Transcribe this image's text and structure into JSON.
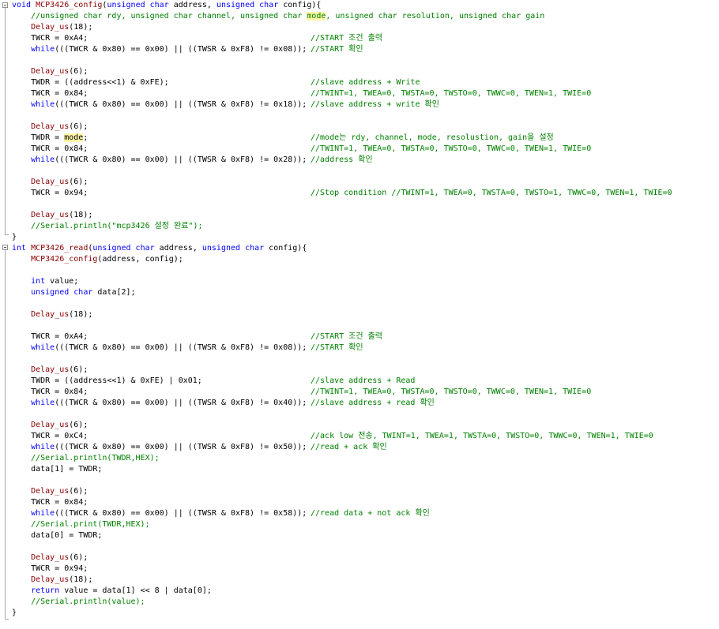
{
  "editor": {
    "lines": [
      {
        "segments": [
          {
            "t": "void",
            "c": "kw"
          },
          {
            "t": " "
          },
          {
            "t": "MCP3426_config",
            "c": "fn"
          },
          {
            "t": "("
          },
          {
            "t": "unsigned char",
            "c": "kw"
          },
          {
            "t": " address, "
          },
          {
            "t": "unsigned char",
            "c": "kw"
          },
          {
            "t": " config){"
          }
        ]
      },
      {
        "segments": [
          {
            "t": "    //unsigned char rdy, unsigned char channel, unsigned char ",
            "c": "green"
          },
          {
            "t": "mode",
            "c": "green hl"
          },
          {
            "t": ", unsigned char resolution, unsigned char gain",
            "c": "green"
          }
        ]
      },
      {
        "segments": [
          {
            "t": "    "
          },
          {
            "t": "Delay_us",
            "c": "fn"
          },
          {
            "t": "(18);"
          }
        ]
      },
      {
        "segments": [
          {
            "t": "    TWCR = 0xA4;"
          }
        ],
        "comment": "//START 조건 출력"
      },
      {
        "segments": [
          {
            "t": "    "
          },
          {
            "t": "while",
            "c": "kw"
          },
          {
            "t": "(((TWCR & 0x80) == 0x00) || ((TWSR & 0xF8) != 0x08));"
          }
        ],
        "comment": "//START 확인"
      },
      {
        "segments": [
          {
            "t": ""
          }
        ]
      },
      {
        "segments": [
          {
            "t": "    "
          },
          {
            "t": "Delay_us",
            "c": "fn"
          },
          {
            "t": "(6);"
          }
        ]
      },
      {
        "segments": [
          {
            "t": "    TWDR = ((address<<1) & 0xFE);"
          }
        ],
        "comment": "//slave address + Write"
      },
      {
        "segments": [
          {
            "t": "    TWCR = 0x84;"
          }
        ],
        "comment": "//TWINT=1, TWEA=0, TWSTA=0, TWSTO=0, TWWC=0, TWEN=1, TWIE=0"
      },
      {
        "segments": [
          {
            "t": "    "
          },
          {
            "t": "while",
            "c": "kw"
          },
          {
            "t": "(((TWCR & 0x80) == 0x00) || ((TWSR & 0xF8) != 0x18));"
          }
        ],
        "comment": "//slave address + write 확인"
      },
      {
        "segments": [
          {
            "t": ""
          }
        ]
      },
      {
        "segments": [
          {
            "t": "    "
          },
          {
            "t": "Delay_us",
            "c": "fn"
          },
          {
            "t": "(6);"
          }
        ]
      },
      {
        "segments": [
          {
            "t": "    TWDR = "
          },
          {
            "t": "mode",
            "c": "hl"
          },
          {
            "t": ";"
          }
        ],
        "comment": "//mode는 rdy, channel, mode, resolustion, gain을 설정"
      },
      {
        "segments": [
          {
            "t": "    TWCR = 0x84;"
          }
        ],
        "comment": "//TWINT=1, TWEA=0, TWSTA=0, TWSTO=0, TWWC=0, TWEN=1, TWIE=0"
      },
      {
        "segments": [
          {
            "t": "    "
          },
          {
            "t": "while",
            "c": "kw"
          },
          {
            "t": "(((TWCR & 0x80) == 0x00) || ((TWSR & 0xF8) != 0x28));"
          }
        ],
        "comment": "//address 확인"
      },
      {
        "segments": [
          {
            "t": ""
          }
        ]
      },
      {
        "segments": [
          {
            "t": "    "
          },
          {
            "t": "Delay_us",
            "c": "fn"
          },
          {
            "t": "(6);"
          }
        ]
      },
      {
        "segments": [
          {
            "t": "    TWCR = 0x94;"
          }
        ],
        "comment": "//Stop condition //TWINT=1, TWEA=0, TWSTA=0, TWSTO=1, TWWC=0, TWEN=1, TWIE=0"
      },
      {
        "segments": [
          {
            "t": ""
          }
        ]
      },
      {
        "segments": [
          {
            "t": "    "
          },
          {
            "t": "Delay_us",
            "c": "fn"
          },
          {
            "t": "(18);"
          }
        ]
      },
      {
        "segments": [
          {
            "t": "    //Serial.println(\"mcp3426 설정 완료\");",
            "c": "green"
          }
        ]
      },
      {
        "segments": [
          {
            "t": "}"
          }
        ]
      },
      {
        "segments": [
          {
            "t": "int",
            "c": "kw"
          },
          {
            "t": " "
          },
          {
            "t": "MCP3426_read",
            "c": "fn"
          },
          {
            "t": "("
          },
          {
            "t": "unsigned char",
            "c": "kw"
          },
          {
            "t": " address, "
          },
          {
            "t": "unsigned char",
            "c": "kw"
          },
          {
            "t": " config){"
          }
        ]
      },
      {
        "segments": [
          {
            "t": "    "
          },
          {
            "t": "MCP3426_config",
            "c": "fn"
          },
          {
            "t": "(address, config);"
          }
        ]
      },
      {
        "segments": [
          {
            "t": ""
          }
        ]
      },
      {
        "segments": [
          {
            "t": "    "
          },
          {
            "t": "int",
            "c": "kw"
          },
          {
            "t": " value;"
          }
        ]
      },
      {
        "segments": [
          {
            "t": "    "
          },
          {
            "t": "unsigned char",
            "c": "kw"
          },
          {
            "t": " data[2];"
          }
        ]
      },
      {
        "segments": [
          {
            "t": ""
          }
        ]
      },
      {
        "segments": [
          {
            "t": "    "
          },
          {
            "t": "Delay_us",
            "c": "fn"
          },
          {
            "t": "(18);"
          }
        ]
      },
      {
        "segments": [
          {
            "t": ""
          }
        ]
      },
      {
        "segments": [
          {
            "t": "    TWCR = 0xA4;"
          }
        ],
        "comment": "//START 조건 출력"
      },
      {
        "segments": [
          {
            "t": "    "
          },
          {
            "t": "while",
            "c": "kw"
          },
          {
            "t": "(((TWCR & 0x80) == 0x00) || ((TWSR & 0xF8) != 0x08));"
          }
        ],
        "comment": "//START 확인"
      },
      {
        "segments": [
          {
            "t": ""
          }
        ]
      },
      {
        "segments": [
          {
            "t": "    "
          },
          {
            "t": "Delay_us",
            "c": "fn"
          },
          {
            "t": "(6);"
          }
        ]
      },
      {
        "segments": [
          {
            "t": "    TWDR = ((address<<1) & 0xFE) | 0x01;"
          }
        ],
        "comment": "//slave address + Read"
      },
      {
        "segments": [
          {
            "t": "    TWCR = 0x84;"
          }
        ],
        "comment": "//TWINT=1, TWEA=0, TWSTA=0, TWSTO=0, TWWC=0, TWEN=1, TWIE=0"
      },
      {
        "segments": [
          {
            "t": "    "
          },
          {
            "t": "while",
            "c": "kw"
          },
          {
            "t": "(((TWCR & 0x80) == 0x00) || ((TWSR & 0xF8) != 0x40));"
          }
        ],
        "comment": "//slave address + read 확인"
      },
      {
        "segments": [
          {
            "t": ""
          }
        ]
      },
      {
        "segments": [
          {
            "t": "    "
          },
          {
            "t": "Delay_us",
            "c": "fn"
          },
          {
            "t": "(6);"
          }
        ]
      },
      {
        "segments": [
          {
            "t": "    TWCR = 0xC4;"
          }
        ],
        "comment": "//ack low 전송, TWINT=1, TWEA=1, TWSTA=0, TWSTO=0, TWWC=0, TWEN=1, TWIE=0"
      },
      {
        "segments": [
          {
            "t": "    "
          },
          {
            "t": "while",
            "c": "kw"
          },
          {
            "t": "(((TWCR & 0x80) == 0x00) || ((TWSR & 0xF8) != 0x50));"
          }
        ],
        "comment": "//read + ack 확인"
      },
      {
        "segments": [
          {
            "t": "    //Serial.println(TWDR,HEX);",
            "c": "green"
          }
        ]
      },
      {
        "segments": [
          {
            "t": "    data[1] = TWDR;"
          }
        ]
      },
      {
        "segments": [
          {
            "t": ""
          }
        ]
      },
      {
        "segments": [
          {
            "t": "    "
          },
          {
            "t": "Delay_us",
            "c": "fn"
          },
          {
            "t": "(6);"
          }
        ]
      },
      {
        "segments": [
          {
            "t": "    TWCR = 0x84;"
          }
        ]
      },
      {
        "segments": [
          {
            "t": "    "
          },
          {
            "t": "while",
            "c": "kw"
          },
          {
            "t": "(((TWCR & 0x80) == 0x00) || ((TWSR & 0xF8) != 0x58));"
          }
        ],
        "comment": "//read data + not ack 확인"
      },
      {
        "segments": [
          {
            "t": "    //Serial.print(TWDR,HEX);",
            "c": "green"
          }
        ]
      },
      {
        "segments": [
          {
            "t": "    data[0] = TWDR;"
          }
        ]
      },
      {
        "segments": [
          {
            "t": ""
          }
        ]
      },
      {
        "segments": [
          {
            "t": "    "
          },
          {
            "t": "Delay_us",
            "c": "fn"
          },
          {
            "t": "(6);"
          }
        ]
      },
      {
        "segments": [
          {
            "t": "    TWCR = 0x94;"
          }
        ]
      },
      {
        "segments": [
          {
            "t": "    "
          },
          {
            "t": "Delay_us",
            "c": "fn"
          },
          {
            "t": "(18);"
          }
        ]
      },
      {
        "segments": [
          {
            "t": "    "
          },
          {
            "t": "return",
            "c": "kw"
          },
          {
            "t": " value = data[1] << 8 | data[0];"
          }
        ]
      },
      {
        "segments": [
          {
            "t": "    //Serial.println(value);",
            "c": "green"
          }
        ]
      },
      {
        "segments": [
          {
            "t": "}"
          }
        ]
      }
    ]
  },
  "colors": {
    "keyword": "#0000ff",
    "function": "#880000",
    "comment": "#008000",
    "highlight": "#fff6a8"
  }
}
